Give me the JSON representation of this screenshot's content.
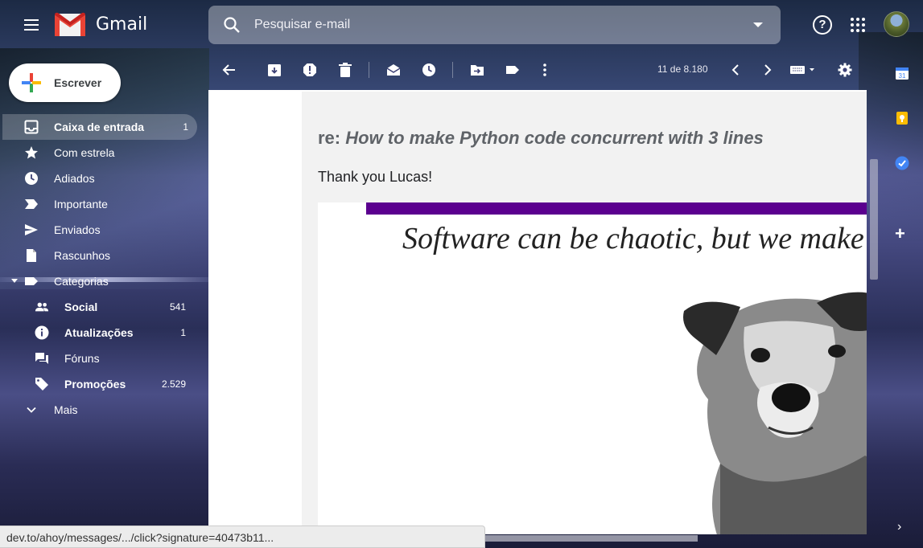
{
  "header": {
    "app_name": "Gmail",
    "search_placeholder": "Pesquisar e-mail"
  },
  "sidebar": {
    "compose_label": "Escrever",
    "items": [
      {
        "label": "Caixa de entrada",
        "count": "1",
        "icon": "inbox-icon",
        "active": true
      },
      {
        "label": "Com estrela",
        "count": "",
        "icon": "star-icon"
      },
      {
        "label": "Adiados",
        "count": "",
        "icon": "clock-icon"
      },
      {
        "label": "Importante",
        "count": "",
        "icon": "important-icon"
      },
      {
        "label": "Enviados",
        "count": "",
        "icon": "send-icon"
      },
      {
        "label": "Rascunhos",
        "count": "",
        "icon": "draft-icon"
      },
      {
        "label": "Categorias",
        "count": "",
        "icon": "label-icon"
      },
      {
        "label": "Social",
        "count": "541",
        "icon": "people-icon"
      },
      {
        "label": "Atualizações",
        "count": "1",
        "icon": "info-icon"
      },
      {
        "label": "Fóruns",
        "count": "",
        "icon": "forum-icon"
      },
      {
        "label": "Promoções",
        "count": "2.529",
        "icon": "tag-icon"
      },
      {
        "label": "Mais",
        "count": "",
        "icon": "chevron-down-icon"
      }
    ]
  },
  "toolbar": {
    "pager": "11 de 8.180"
  },
  "email": {
    "subject_prefix": "re: ",
    "subject_title": "How to make Python code concurrent with 3 lines",
    "greeting": "Thank you Lucas!",
    "banner_text": "Software can be chaotic, but we make it"
  },
  "statusbar": {
    "url": "dev.to/ahoy/messages/.../click?signature=40473b11..."
  },
  "side_panel": {
    "calendar_day": "31"
  },
  "colors": {
    "banner_bar": "#5b008f",
    "gmail_red": "#ea4335"
  }
}
